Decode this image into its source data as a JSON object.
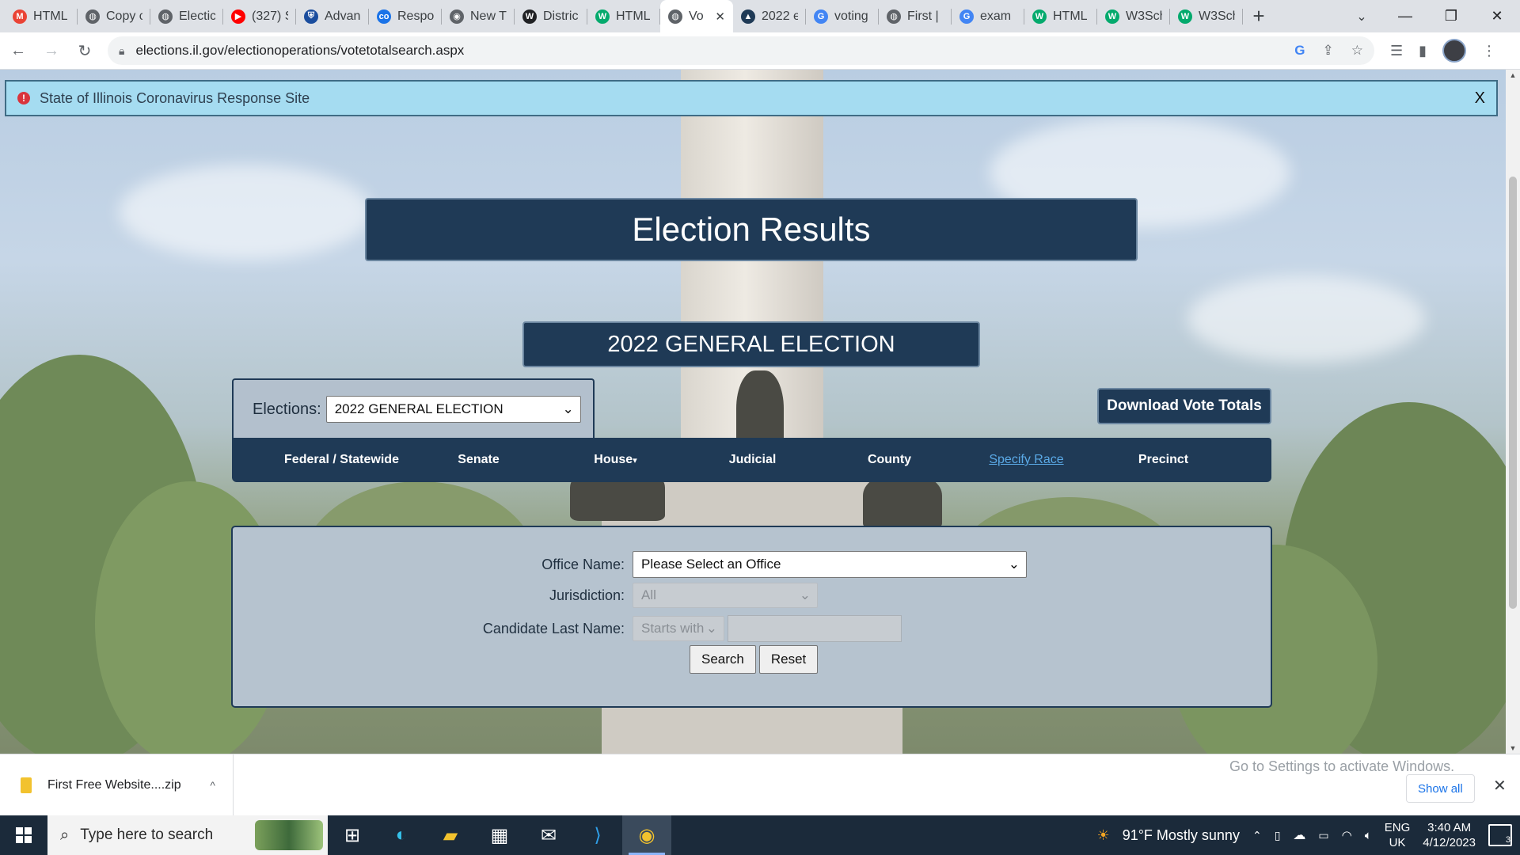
{
  "browser": {
    "tabs": [
      {
        "title": "HTML",
        "icon": "gmail-icon",
        "color": "#ea4335",
        "glyph": "M"
      },
      {
        "title": "Copy c",
        "icon": "globe-icon",
        "color": "#5f6368",
        "glyph": "◍"
      },
      {
        "title": "Electic",
        "icon": "globe-icon",
        "color": "#5f6368",
        "glyph": "◍"
      },
      {
        "title": "(327) S",
        "icon": "youtube-icon",
        "color": "#ff0000",
        "glyph": "▶"
      },
      {
        "title": "Advan",
        "icon": "shield-icon",
        "color": "#1a4d9e",
        "glyph": "⛨"
      },
      {
        "title": "Respo",
        "icon": "app-icon",
        "color": "#1a73e8",
        "glyph": "co"
      },
      {
        "title": "New T",
        "icon": "chrome-icon",
        "color": "#5f6368",
        "glyph": "◉"
      },
      {
        "title": "Distric",
        "icon": "wikipedia-icon",
        "color": "#202124",
        "glyph": "W"
      },
      {
        "title": "HTML",
        "icon": "w3schools-icon",
        "color": "#04aa6d",
        "glyph": "W"
      },
      {
        "title": "Vo",
        "icon": "globe-icon",
        "color": "#5f6368",
        "glyph": "◍",
        "active": true
      },
      {
        "title": "2022 e",
        "icon": "document-icon",
        "color": "#1f3a56",
        "glyph": "▲"
      },
      {
        "title": "voting",
        "icon": "google-icon",
        "color": "#4285f4",
        "glyph": "G"
      },
      {
        "title": "First |",
        "icon": "globe-icon",
        "color": "#5f6368",
        "glyph": "◍"
      },
      {
        "title": "exam",
        "icon": "google-icon",
        "color": "#4285f4",
        "glyph": "G"
      },
      {
        "title": "HTML",
        "icon": "w3schools-icon",
        "color": "#04aa6d",
        "glyph": "W"
      },
      {
        "title": "W3Sch",
        "icon": "w3schools-icon",
        "color": "#04aa6d",
        "glyph": "W"
      },
      {
        "title": "W3Sch",
        "icon": "w3schools-icon",
        "color": "#04aa6d",
        "glyph": "W"
      }
    ],
    "url": "elections.il.gov/electionoperations/votetotalsearch.aspx"
  },
  "alert": {
    "text": "State of Illinois Coronavirus Response Site",
    "close_label": "X"
  },
  "header": {
    "title": "Election Results",
    "election_banner": "2022 GENERAL ELECTION"
  },
  "elections_filter": {
    "label": "Elections:",
    "selected": "2022 GENERAL ELECTION"
  },
  "download_button": "Download Vote Totals",
  "nav": {
    "federal": "Federal / Statewide",
    "senate": "Senate",
    "house": "House",
    "judicial": "Judicial",
    "county": "County",
    "specify": "Specify Race",
    "precinct": "Precinct"
  },
  "search_form": {
    "office_label": "Office Name:",
    "office_value": "Please Select an Office",
    "jurisdiction_label": "Jurisdiction:",
    "jurisdiction_value": "All",
    "candidate_label": "Candidate Last Name:",
    "candidate_mode": "Starts with",
    "candidate_value": "",
    "search_label": "Search",
    "reset_label": "Reset"
  },
  "download_bar": {
    "file_name": "First Free Website....zip",
    "show_all": "Show all",
    "watermark": "Go to Settings to activate Windows."
  },
  "taskbar": {
    "search_placeholder": "Type here to search",
    "weather": "91°F  Mostly sunny",
    "lang_top": "ENG",
    "lang_bottom": "UK",
    "time": "3:40 AM",
    "date": "4/12/2023",
    "notifications": "3"
  }
}
